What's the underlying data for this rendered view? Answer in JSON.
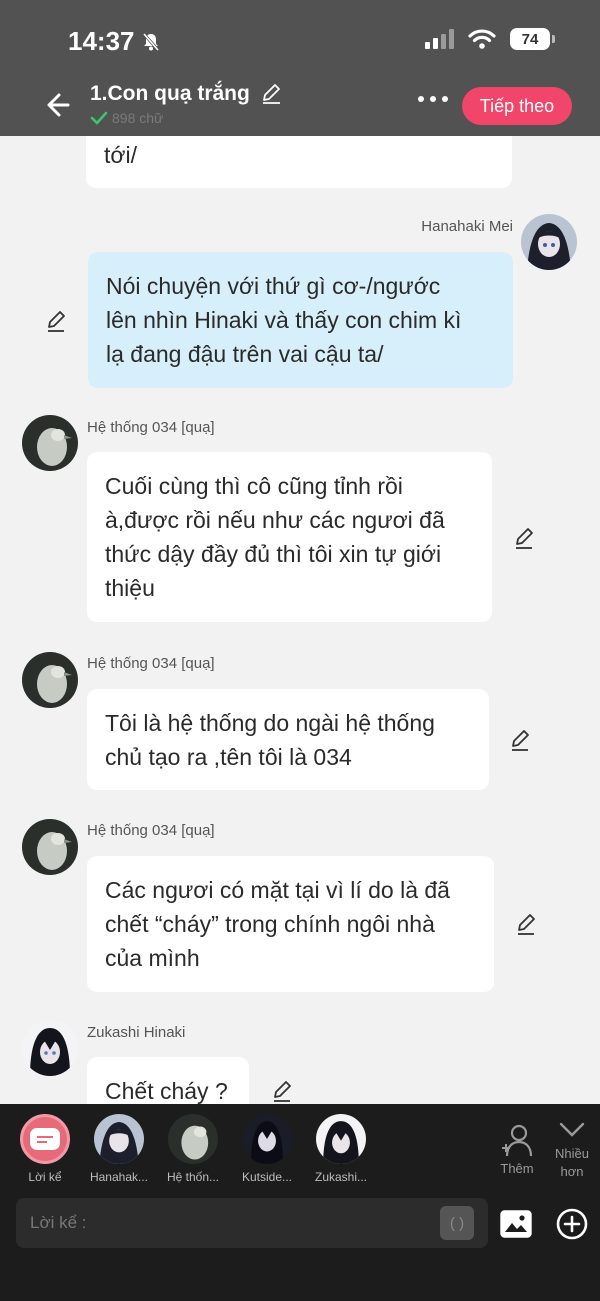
{
  "status_bar": {
    "time": "14:37",
    "battery": "74"
  },
  "header": {
    "title": "1.Con quạ trắng",
    "word_count": "898 chữ",
    "next_label": "Tiếp theo"
  },
  "messages": [
    {
      "type": "partial",
      "text": "tới/"
    },
    {
      "speaker": "Hanahaki Mei",
      "side": "right",
      "lines": [
        "Nói chuyện với thứ gì cơ-/ngước",
        "lên nhìn Hinaki và thấy con chim kì",
        "lạ đang đậu trên vai cậu ta/"
      ]
    },
    {
      "speaker": "Hệ thống 034 [quạ]",
      "side": "left",
      "lines": [
        "Cuối cùng thì cô cũng tỉnh rồi",
        "à,được rồi nếu như các ngươi đã",
        "thức dậy đầy đủ thì tôi xin tự giới",
        "thiệu"
      ]
    },
    {
      "speaker": "Hệ thống 034 [quạ]",
      "side": "left",
      "lines": [
        "Tôi là hệ thống do ngài hệ thống",
        "chủ tạo ra ,tên tôi là 034"
      ]
    },
    {
      "speaker": "Hệ thống 034 [quạ]",
      "side": "left",
      "lines": [
        "Các ngươi có mặt tại vì lí do là đã",
        "chết “cháy” trong chính ngôi nhà",
        "của mình"
      ]
    },
    {
      "speaker": "Zukashi Hinaki",
      "side": "left",
      "lines": [
        "Chết cháy ?"
      ]
    }
  ],
  "characters": [
    {
      "label": "Lời kể"
    },
    {
      "label": "Hanahak..."
    },
    {
      "label": "Hệ thốn..."
    },
    {
      "label": "Kutside..."
    },
    {
      "label": "Zukashi..."
    }
  ],
  "add_label": "Thêm",
  "more_label_1": "Nhiều",
  "more_label_2": "hơn",
  "input": {
    "placeholder": "Lời kể :",
    "bracket": "( )"
  },
  "colors": {
    "header_bg": "#525252",
    "accent": "#f1466a",
    "mine_bubble": "#d7effa",
    "bottom_bg": "#1c1c1c"
  }
}
